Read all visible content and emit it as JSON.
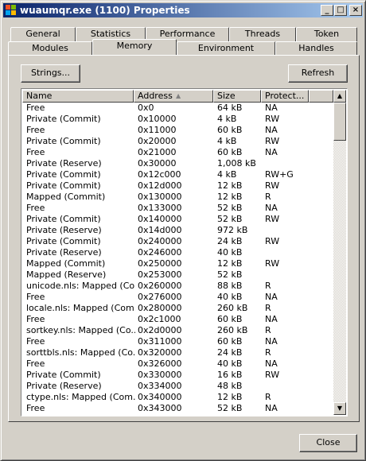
{
  "window": {
    "title": "wuaumqr.exe (1100) Properties"
  },
  "titlebar_buttons": {
    "minimize": "_",
    "maximize": "□",
    "close": "×"
  },
  "tabs_row1": [
    "General",
    "Statistics",
    "Performance",
    "Threads",
    "Token"
  ],
  "tabs_row2": [
    "Modules",
    "Memory",
    "Environment",
    "Handles"
  ],
  "active_tab": "Memory",
  "buttons": {
    "strings": "Strings...",
    "refresh": "Refresh",
    "close": "Close"
  },
  "columns": {
    "name": "Name",
    "address": "Address",
    "sort_indicator": "▲",
    "size": "Size",
    "protection": "Protect..."
  },
  "rows": [
    {
      "name": "Free",
      "address": "0x0",
      "size": "64 kB",
      "protection": "NA"
    },
    {
      "name": "Private (Commit)",
      "address": "0x10000",
      "size": "4 kB",
      "protection": "RW"
    },
    {
      "name": "Free",
      "address": "0x11000",
      "size": "60 kB",
      "protection": "NA"
    },
    {
      "name": "Private (Commit)",
      "address": "0x20000",
      "size": "4 kB",
      "protection": "RW"
    },
    {
      "name": "Free",
      "address": "0x21000",
      "size": "60 kB",
      "protection": "NA"
    },
    {
      "name": "Private (Reserve)",
      "address": "0x30000",
      "size": "1,008 kB",
      "protection": ""
    },
    {
      "name": "Private (Commit)",
      "address": "0x12c000",
      "size": "4 kB",
      "protection": "RW+G"
    },
    {
      "name": "Private (Commit)",
      "address": "0x12d000",
      "size": "12 kB",
      "protection": "RW"
    },
    {
      "name": "Mapped (Commit)",
      "address": "0x130000",
      "size": "12 kB",
      "protection": "R"
    },
    {
      "name": "Free",
      "address": "0x133000",
      "size": "52 kB",
      "protection": "NA"
    },
    {
      "name": "Private (Commit)",
      "address": "0x140000",
      "size": "52 kB",
      "protection": "RW"
    },
    {
      "name": "Private (Reserve)",
      "address": "0x14d000",
      "size": "972 kB",
      "protection": ""
    },
    {
      "name": "Private (Commit)",
      "address": "0x240000",
      "size": "24 kB",
      "protection": "RW"
    },
    {
      "name": "Private (Reserve)",
      "address": "0x246000",
      "size": "40 kB",
      "protection": ""
    },
    {
      "name": "Mapped (Commit)",
      "address": "0x250000",
      "size": "12 kB",
      "protection": "RW"
    },
    {
      "name": "Mapped (Reserve)",
      "address": "0x253000",
      "size": "52 kB",
      "protection": ""
    },
    {
      "name": "unicode.nls: Mapped (Co...",
      "address": "0x260000",
      "size": "88 kB",
      "protection": "R"
    },
    {
      "name": "Free",
      "address": "0x276000",
      "size": "40 kB",
      "protection": "NA"
    },
    {
      "name": "locale.nls: Mapped (Com...",
      "address": "0x280000",
      "size": "260 kB",
      "protection": "R"
    },
    {
      "name": "Free",
      "address": "0x2c1000",
      "size": "60 kB",
      "protection": "NA"
    },
    {
      "name": "sortkey.nls: Mapped (Co...",
      "address": "0x2d0000",
      "size": "260 kB",
      "protection": "R"
    },
    {
      "name": "Free",
      "address": "0x311000",
      "size": "60 kB",
      "protection": "NA"
    },
    {
      "name": "sorttbls.nls: Mapped (Co...",
      "address": "0x320000",
      "size": "24 kB",
      "protection": "R"
    },
    {
      "name": "Free",
      "address": "0x326000",
      "size": "40 kB",
      "protection": "NA"
    },
    {
      "name": "Private (Commit)",
      "address": "0x330000",
      "size": "16 kB",
      "protection": "RW"
    },
    {
      "name": "Private (Reserve)",
      "address": "0x334000",
      "size": "48 kB",
      "protection": ""
    },
    {
      "name": "ctype.nls: Mapped (Com...",
      "address": "0x340000",
      "size": "12 kB",
      "protection": "R"
    },
    {
      "name": "Free",
      "address": "0x343000",
      "size": "52 kB",
      "protection": "NA"
    }
  ],
  "scrollbar": {
    "up_arrow": "▲",
    "down_arrow": "▼"
  },
  "colors": {
    "title_start": "#0a246a",
    "title_end": "#a6caf0",
    "face": "#d4d0c8"
  }
}
